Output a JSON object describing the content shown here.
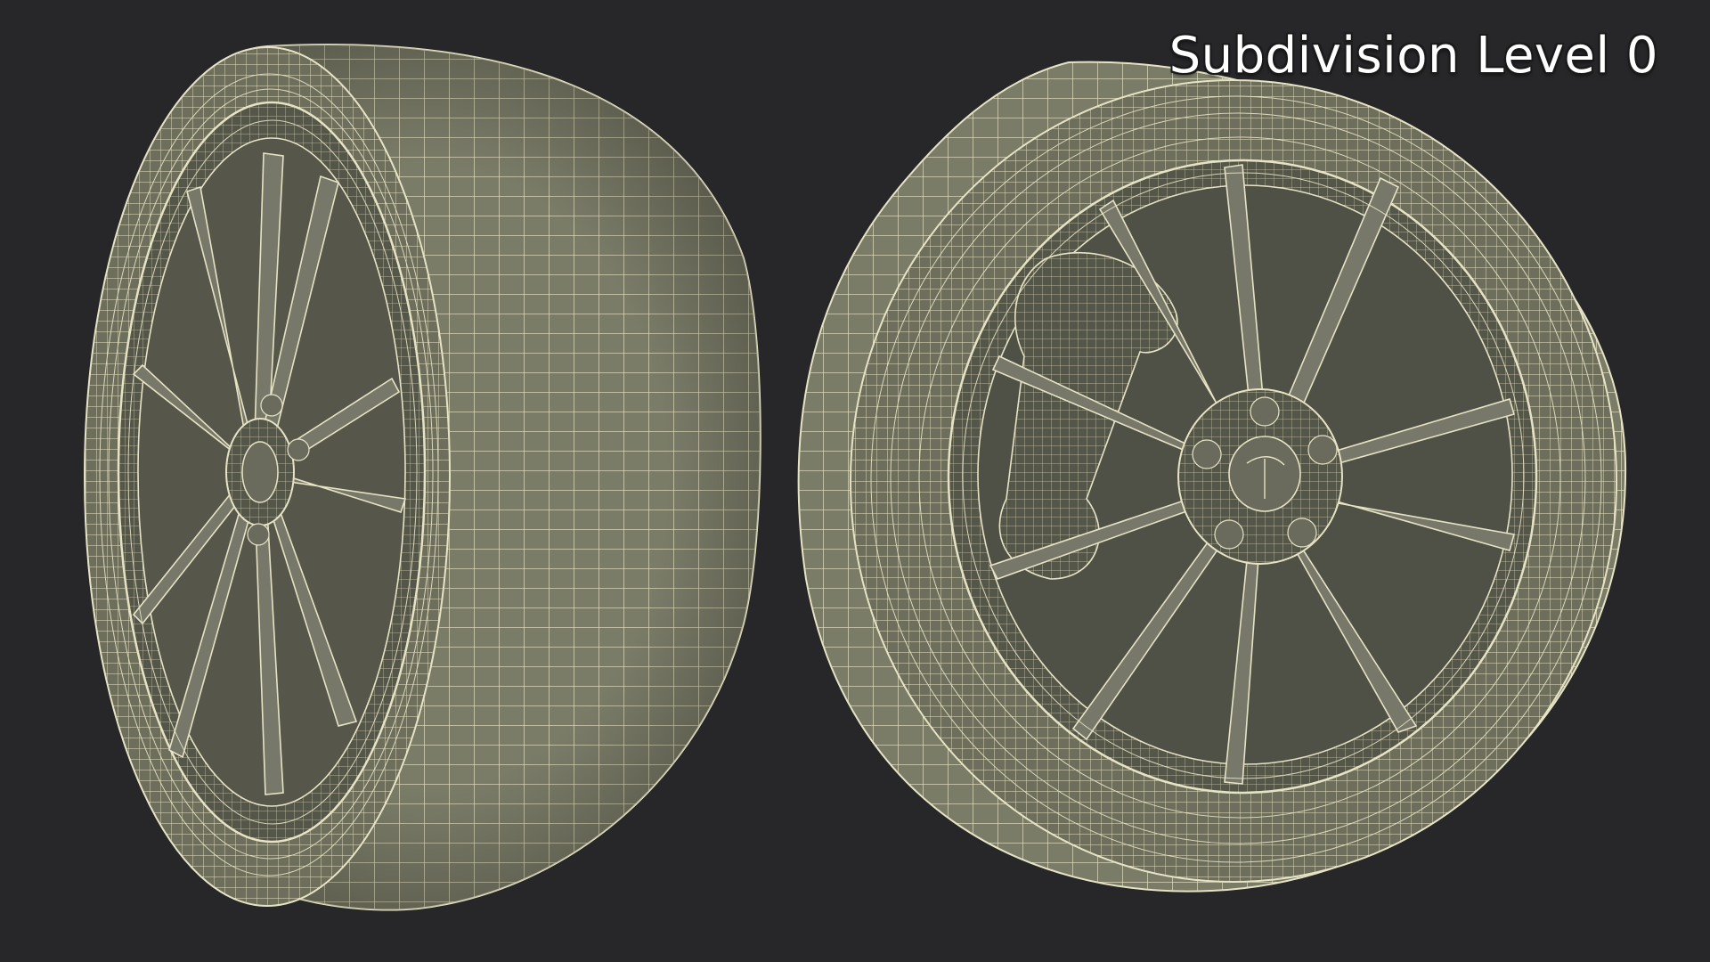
{
  "caption": "Subdivision Level 0",
  "colors": {
    "background": "#27272a",
    "surface": "#7b7c68",
    "surface_dark": "#5e5f50",
    "surface_shadow": "#4a4b3f",
    "wire": "#e6e3c4"
  },
  "objects": [
    {
      "name": "left-wheel",
      "view": "three-quarter side view",
      "spokes": 10
    },
    {
      "name": "right-wheel",
      "view": "three-quarter front view",
      "spokes": 10
    }
  ]
}
